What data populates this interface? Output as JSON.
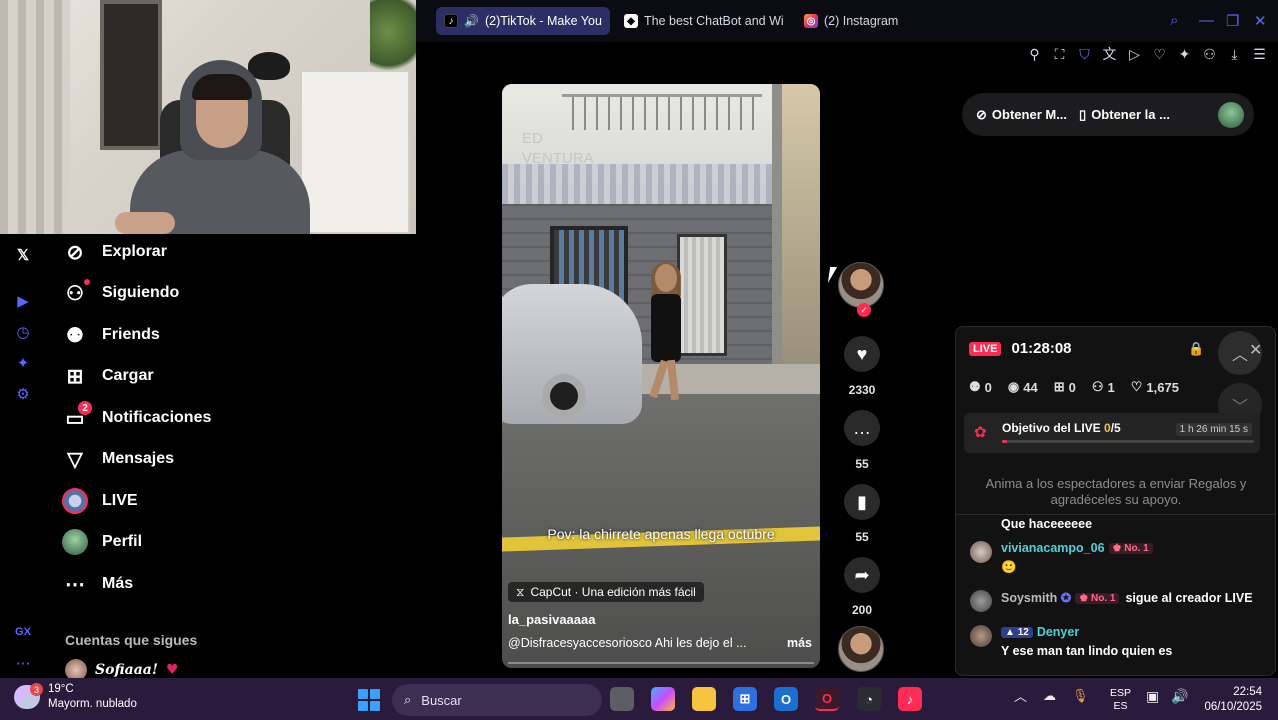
{
  "browser": {
    "tabs": [
      {
        "label": "(2)TikTok - Make You",
        "active": true
      },
      {
        "label": "The best ChatBot and Wi",
        "active": false
      },
      {
        "label": "(2) Instagram",
        "active": false
      }
    ],
    "new_tab": "+",
    "accent": "#5b66ff"
  },
  "nav": {
    "items": [
      {
        "label": "Explorar",
        "icon": "compass-icon"
      },
      {
        "label": "Siguiendo",
        "icon": "user-follow-icon"
      },
      {
        "label": "Friends",
        "icon": "friends-icon"
      },
      {
        "label": "Cargar",
        "icon": "upload-icon"
      },
      {
        "label": "Notificaciones",
        "icon": "inbox-icon",
        "badge": "2"
      },
      {
        "label": "Mensajes",
        "icon": "send-icon"
      },
      {
        "label": "LIVE",
        "icon": "live-avatar"
      },
      {
        "label": "Perfil",
        "icon": "profile-avatar"
      },
      {
        "label": "Más",
        "icon": "more-icon"
      }
    ],
    "following_title": "Cuentas que sigues",
    "following_first": "Sofiaaa!"
  },
  "rail": {
    "bottom_label": "GX"
  },
  "video": {
    "sign_text": "ED\nVENTURA",
    "caption": "Pov: la chirrete apenas llega octubre",
    "capcut": "CapCut · Una edición más fácil",
    "author": "la_pasivaaaaa",
    "description": "@Disfracesyaccesoriosco  Ahi les dejo el ...",
    "more": "más",
    "progress": 0.0
  },
  "actions": {
    "likes": "2330",
    "comments": "55",
    "saves": "55",
    "shares": "200"
  },
  "obtener": {
    "item1": "Obtener M...",
    "item2": "Obtener la ..."
  },
  "live": {
    "tag": "LIVE",
    "timer": "01:28:08",
    "stats": {
      "viewers_rank": "0",
      "views": "44",
      "gifts": "0",
      "new_followers": "1",
      "likes": "1,675"
    },
    "goal": {
      "title_prefix": "Objetivo del LIVE ",
      "current": "0",
      "target": "/5",
      "time_left": "1 h 26 min 15 s",
      "progress": 0.0
    },
    "hint": "Anima a los espectadores a enviar Regalos y agradéceles su apoyo.",
    "chat": {
      "truncated_top": "Que haceeeeee",
      "messages": [
        {
          "user": "vivianacampo_06",
          "badge": "No. 1",
          "text": "🙂",
          "user_color": "#4fd1d9"
        },
        {
          "user": "Soysmith",
          "badge": "No. 1",
          "inline": "sigue al creador LIVE",
          "user_color": "#bdbdbd"
        },
        {
          "user": "Denyer",
          "level": "12",
          "text": "Y ese man tan lindo quien es",
          "user_color": "#4fd1d9"
        }
      ]
    }
  },
  "taskbar": {
    "weather_temp": "19°C",
    "weather_desc": "Mayorm. nublado",
    "weather_badge": "3",
    "search_placeholder": "Buscar",
    "lang_top": "ESP",
    "lang_bottom": "ES",
    "time": "22:54",
    "date": "06/10/2025"
  }
}
